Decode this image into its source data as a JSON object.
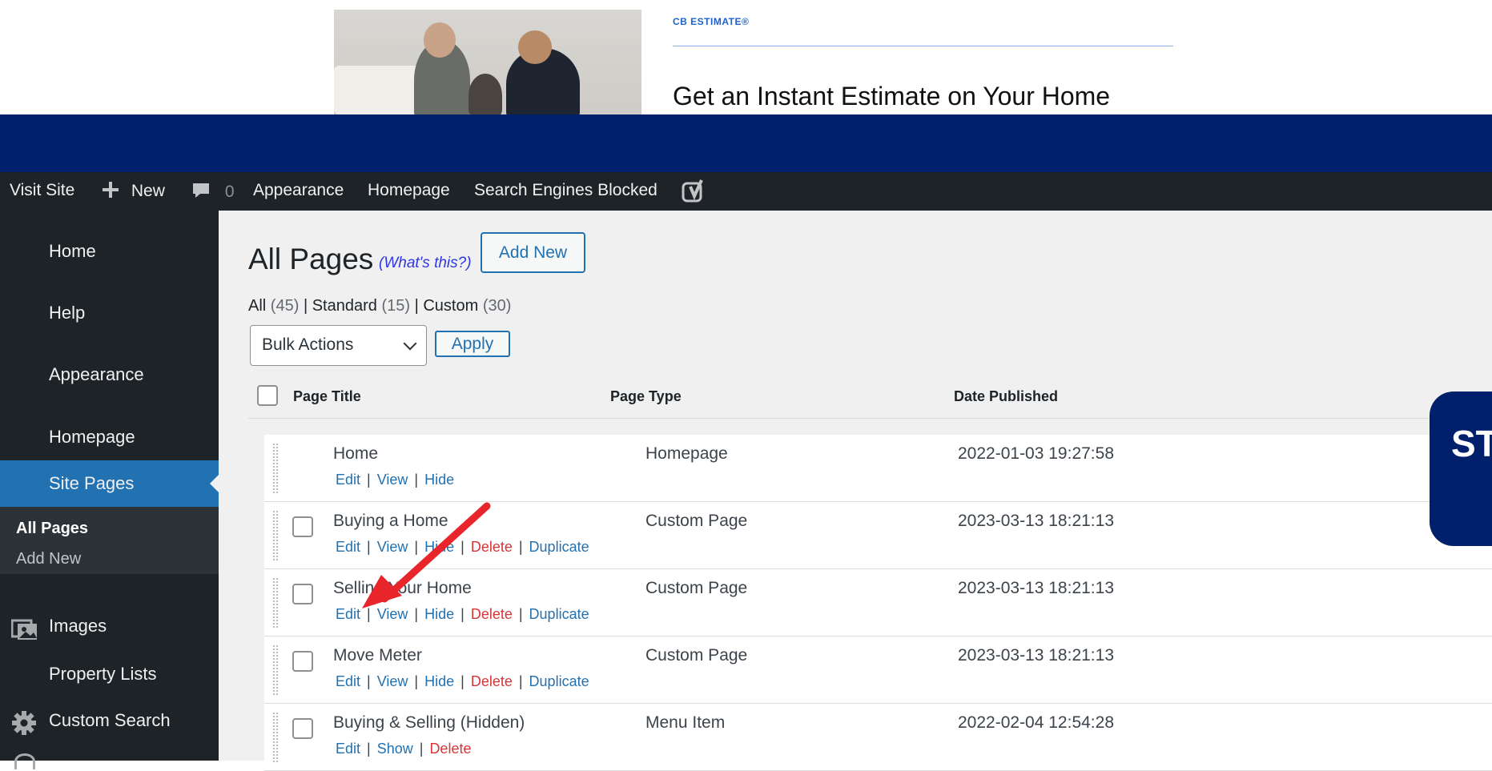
{
  "promo": {
    "eyebrow": "CB ESTIMATE®",
    "headline": "Get an Instant Estimate on Your Home"
  },
  "adminbar": {
    "visit_site": "Visit Site",
    "new": "New",
    "comments_count": "0",
    "appearance": "Appearance",
    "homepage": "Homepage",
    "search_engines": "Search Engines Blocked"
  },
  "sidebar": {
    "items": [
      {
        "label": "Home"
      },
      {
        "label": "Help"
      },
      {
        "label": "Appearance"
      },
      {
        "label": "Homepage"
      },
      {
        "label": "Site Pages"
      },
      {
        "label": "Images"
      },
      {
        "label": "Property Lists"
      },
      {
        "label": "Custom Search"
      }
    ],
    "submenu": [
      {
        "label": "All Pages"
      },
      {
        "label": "Add New"
      }
    ]
  },
  "main": {
    "title": "All Pages",
    "whats_this": "(What's this?)",
    "add_new": "Add New",
    "filters": {
      "all": "All",
      "all_count": "(45)",
      "standard": "Standard",
      "standard_count": "(15)",
      "custom": "Custom",
      "custom_count": "(30)"
    },
    "bulk_actions": "Bulk Actions",
    "apply": "Apply",
    "columns": [
      "Page Title",
      "Page Type",
      "Date Published"
    ],
    "rows": [
      {
        "title": "Home",
        "type": "Homepage",
        "date": "2022-01-03 19:27:58",
        "actions": [
          "Edit",
          "View",
          "Hide"
        ]
      },
      {
        "title": "Buying a Home",
        "type": "Custom Page",
        "date": "2023-03-13 18:21:13",
        "actions": [
          "Edit",
          "View",
          "Hide",
          "Delete",
          "Duplicate"
        ]
      },
      {
        "title": "Selling Your Home",
        "type": "Custom Page",
        "date": "2023-03-13 18:21:13",
        "actions": [
          "Edit",
          "View",
          "Hide",
          "Delete",
          "Duplicate"
        ]
      },
      {
        "title": "Move Meter",
        "type": "Custom Page",
        "date": "2023-03-13 18:21:13",
        "actions": [
          "Edit",
          "View",
          "Hide",
          "Delete",
          "Duplicate"
        ]
      },
      {
        "title": "Buying & Selling (Hidden)",
        "type": "Menu Item",
        "date": "2022-02-04 12:54:28",
        "actions": [
          "Edit",
          "Show",
          "Delete"
        ]
      }
    ]
  },
  "callout": {
    "text": "ST"
  },
  "colors": {
    "brand_navy": "#00206b",
    "wp_blue": "#2271b1",
    "delete_red": "#d63638",
    "annotation_red": "#e8252b"
  }
}
